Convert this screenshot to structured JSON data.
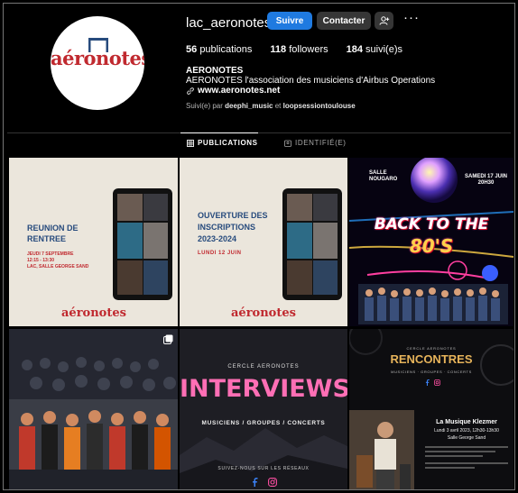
{
  "profile": {
    "username": "lac_aeronotes",
    "follow_label": "Suivre",
    "contact_label": "Contacter",
    "more_label": "···",
    "avatar_logo": "aéronotes"
  },
  "stats": {
    "publications_count": "56",
    "publications_label": "publications",
    "followers_count": "118",
    "followers_label": "followers",
    "following_count": "184",
    "following_label": "suivi(e)s"
  },
  "bio": {
    "name": "AERONOTES",
    "description": "AERONOTES l'association des musiciens d'Airbus Operations",
    "link": "www.aeronotes.net",
    "followed_prefix": "Suivi(e) par",
    "followed_user1": "deephi_music",
    "followed_sep": "et",
    "followed_user2": "loopsessiontoulouse"
  },
  "tabs": {
    "publications": "PUBLICATIONS",
    "tagged": "IDENTIFIÉ(E)"
  },
  "posts": {
    "p1": {
      "title_line1": "REUNION DE",
      "title_line2": "RENTREE",
      "date": "JEUDI 7 SEPTEMBRE",
      "time": "12:15 - 13:30",
      "place": "LAC, SALLE GEORGE SAND",
      "logo": "aéronotes"
    },
    "p2": {
      "title_line1": "OUVERTURE DES",
      "title_line2": "INSCRIPTIONS",
      "title_line3": "2023-2024",
      "date": "LUNDI 12 JUIN",
      "logo": "aéronotes"
    },
    "p3": {
      "venue_line1": "SALLE",
      "venue_line2": "NOUGARO",
      "date_line1": "SAMEDI 17 JUIN",
      "date_line2": "20H30",
      "title_line1": "BACK TO THE",
      "title_line2": "80'S"
    },
    "p5": {
      "kicker": "CERCLE AERONOTES",
      "title": "INTERVIEWS",
      "subtitle": "MUSICIENS / GROUPES / CONCERTS",
      "footer": "SUIVEZ-NOUS SUR LES RÉSEAUX"
    },
    "p6": {
      "kicker": "CERCLE AERONOTES",
      "title": "RENCONTRES",
      "sub": "MUSICIENS · GROUPES · CONCERTS",
      "event": "La Musique Klezmer",
      "event_date": "Lundi 3 avril 2023, 12h30-13h30",
      "event_place": "Salle George Sand"
    }
  },
  "colors": {
    "follow_button": "#1f7ae0",
    "secondary_button": "#363636",
    "brand_red": "#c0292f",
    "brand_navy": "#274b7d",
    "interviews_pink": "#ff6fb5",
    "rencontres_gold": "#e6b35a"
  }
}
